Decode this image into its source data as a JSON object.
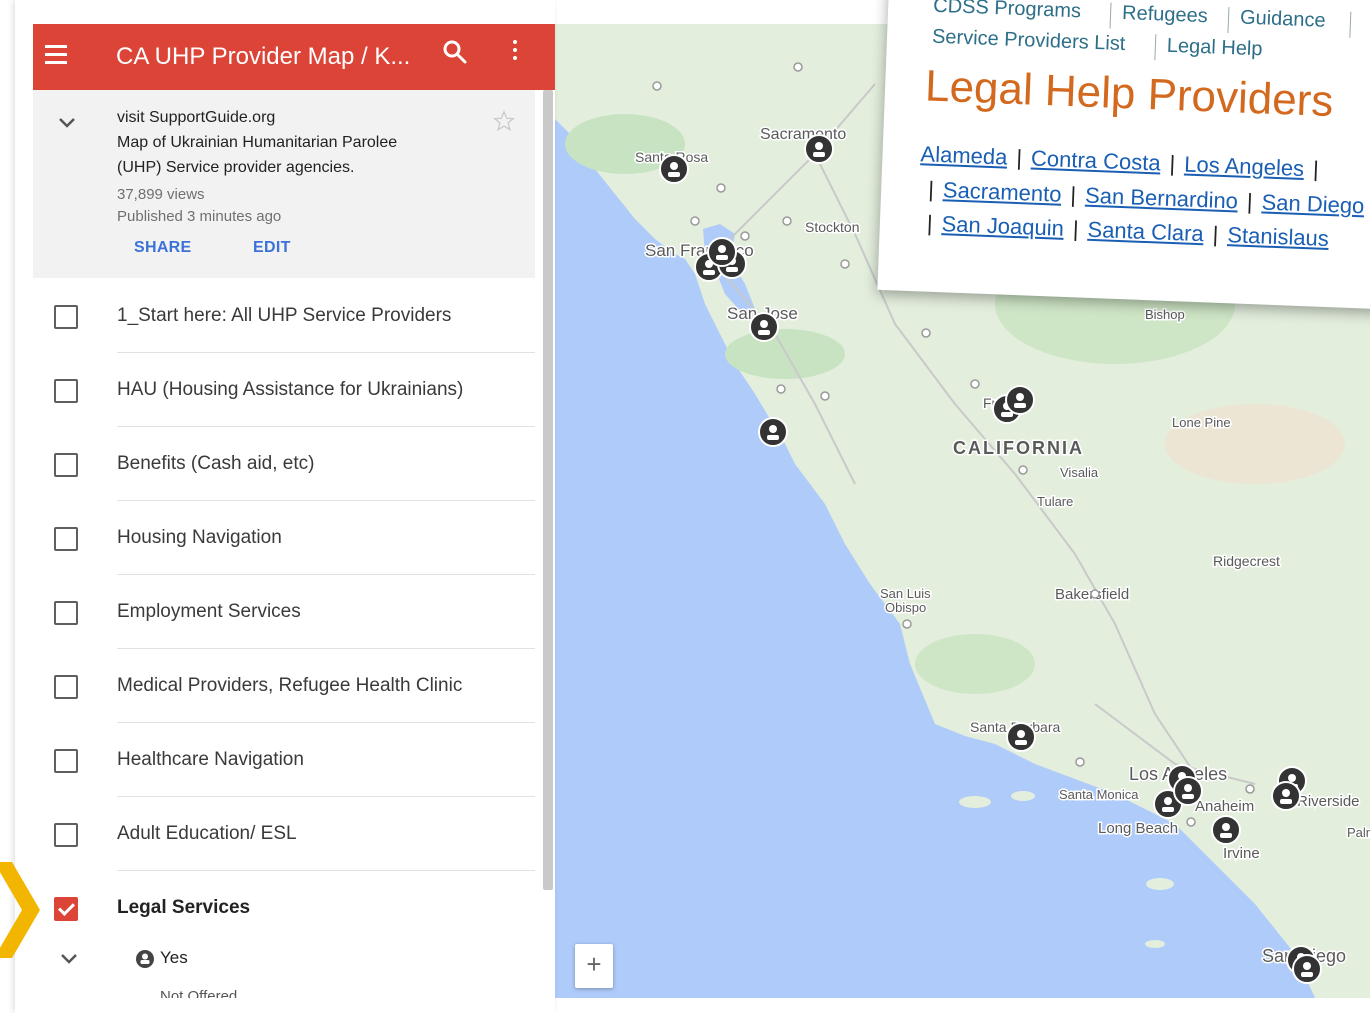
{
  "header": {
    "title": "CA UHP Provider Map / K...",
    "menu_icon": "menu-icon",
    "search_icon": "search-icon",
    "more_icon": "more-vert-icon",
    "color": "#db4437"
  },
  "info": {
    "line1": "visit SupportGuide.org",
    "line2": "Map of Ukrainian Humanitarian Parolee",
    "line3": "(UHP) Service provider agencies.",
    "views": "37,899 views",
    "published": "Published 3 minutes ago",
    "share": "SHARE",
    "edit": "EDIT"
  },
  "layers": [
    {
      "label": "1_Start here: All UHP Service Providers",
      "checked": false
    },
    {
      "label": "HAU (Housing Assistance for Ukrainians)",
      "checked": false
    },
    {
      "label": "Benefits (Cash aid, etc)",
      "checked": false
    },
    {
      "label": "Housing Navigation",
      "checked": false
    },
    {
      "label": "Employment Services",
      "checked": false
    },
    {
      "label": "Medical Providers, Refugee Health Clinic",
      "checked": false
    },
    {
      "label": "Healthcare Navigation",
      "checked": false
    },
    {
      "label": "Adult Education/ ESL",
      "checked": false
    },
    {
      "label": "Legal Services",
      "checked": true
    }
  ],
  "legend": {
    "yes": "Yes",
    "not_offered": "Not Offered"
  },
  "map": {
    "labels": {
      "sacramento": "Sacramento",
      "santa_rosa": "Santa Rosa",
      "san_francisco": "San Francisco",
      "stockton": "Stockton",
      "san_jose": "San Jose",
      "fresno": "Fresno",
      "california": "CALIFORNIA",
      "visalia": "Visalia",
      "tulare": "Tulare",
      "lone_pine": "Lone Pine",
      "bishop": "Bishop",
      "ridgecrest": "Ridgecrest",
      "bakersfield": "Bakersfield",
      "san_luis_obispo_1": "San Luis",
      "san_luis_obispo_2": "Obispo",
      "santa_barbara": "Santa Barbara",
      "los_angeles": "Los Angeles",
      "santa_monica": "Santa Monica",
      "anaheim": "Anaheim",
      "riverside": "Riverside",
      "long_beach": "Long Beach",
      "irvine": "Irvine",
      "palm": "Palm",
      "san_diego": "San Diego"
    },
    "zoom_in": "+",
    "ocean_color": "#aecbfa",
    "land_color": "#e3eedd"
  },
  "card": {
    "nav_row1": [
      "CDSS Programs",
      "Refugees",
      "Guidance"
    ],
    "nav_row2": [
      "Service Providers List",
      "Legal Help"
    ],
    "heading": "Legal Help Providers",
    "links_row1": [
      "Alameda",
      "Contra Costa",
      "Los Angeles"
    ],
    "links_row2": [
      "Sacramento",
      "San Bernardino",
      "San Diego"
    ],
    "links_row3": [
      "San Joaquin",
      "Santa Clara",
      "Stanislaus"
    ]
  }
}
